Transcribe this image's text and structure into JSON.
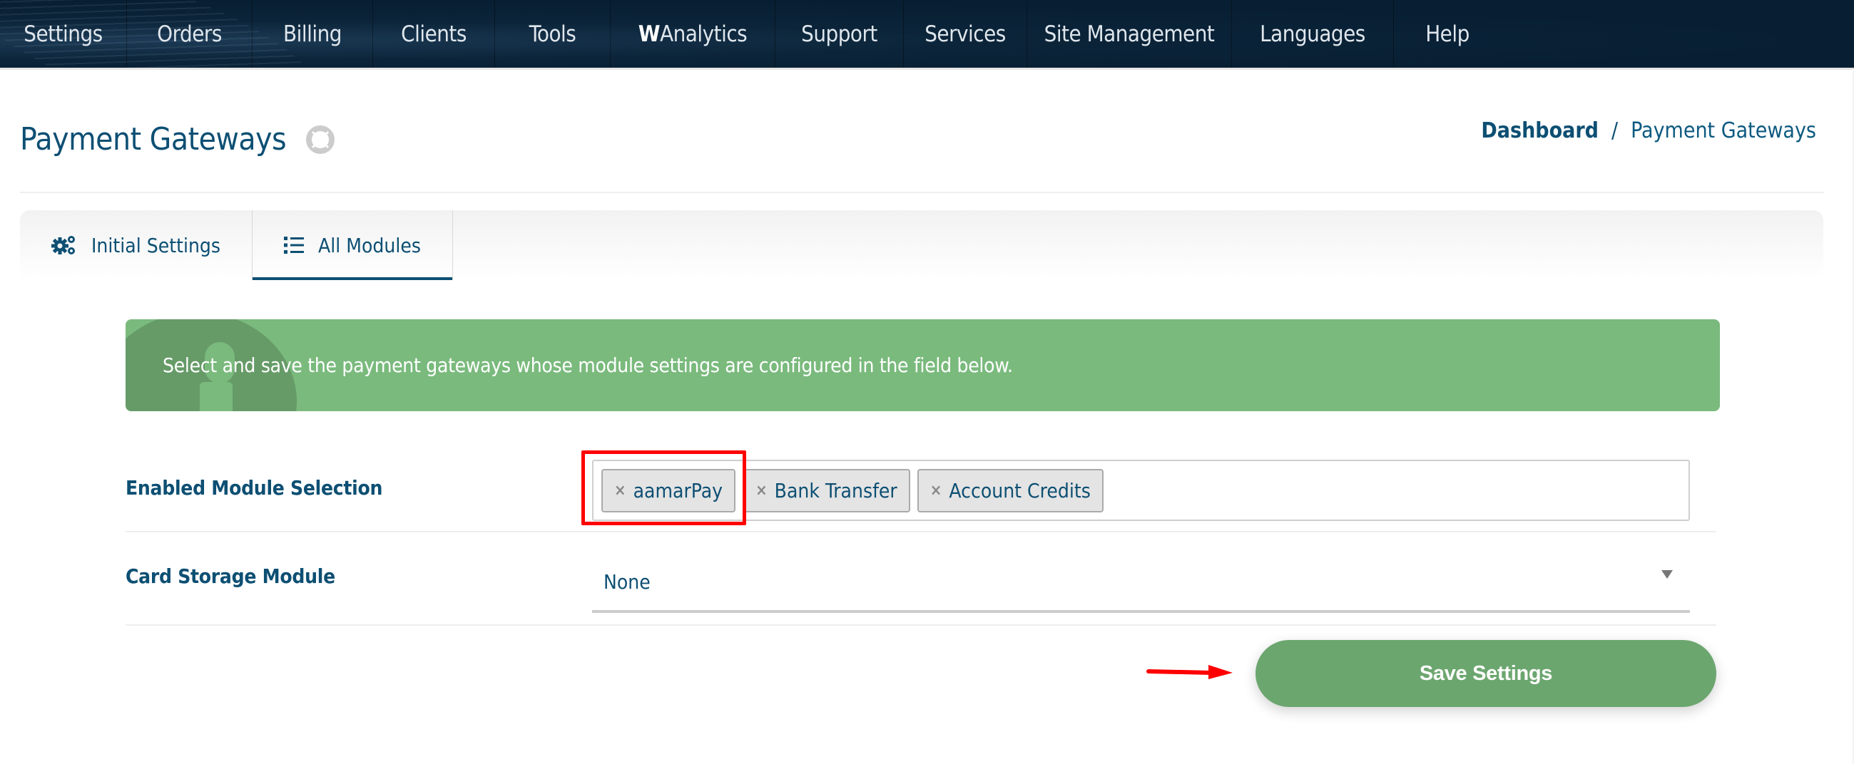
{
  "nav": {
    "items": [
      {
        "label": "Settings"
      },
      {
        "label": "Orders"
      },
      {
        "label": "Billing"
      },
      {
        "label": "Clients"
      },
      {
        "label": "Tools"
      },
      {
        "label_bold": "W",
        "label": "Analytics"
      },
      {
        "label": "Support"
      },
      {
        "label": "Services"
      },
      {
        "label": "Site Management"
      },
      {
        "label": "Languages"
      },
      {
        "label": "Help"
      }
    ]
  },
  "header": {
    "title": "Payment Gateways",
    "help_icon": "lifebuoy-icon",
    "breadcrumb": {
      "home": "Dashboard",
      "separator": "/",
      "current": "Payment Gateways"
    }
  },
  "tabs": [
    {
      "label": "Initial Settings",
      "icon": "gears-icon",
      "active": false
    },
    {
      "label": "All Modules",
      "icon": "list-icon",
      "active": true
    }
  ],
  "alert": {
    "icon": "info-icon",
    "text": "Select and save the payment gateways whose module settings are configured in the field below.",
    "color": "#7aba7d"
  },
  "form": {
    "enabled_modules": {
      "label": "Enabled Module Selection",
      "remove_symbol": "×",
      "tags": [
        "aamarPay",
        "Bank Transfer",
        "Account Credits"
      ]
    },
    "card_storage": {
      "label": "Card Storage Module",
      "selected": "None"
    },
    "save_label": "Save Settings"
  },
  "colors": {
    "nav_bg": "#081f33",
    "primary_text": "#0d4f73",
    "save_button": "#6ca66f",
    "annotation": "#ff0000"
  }
}
